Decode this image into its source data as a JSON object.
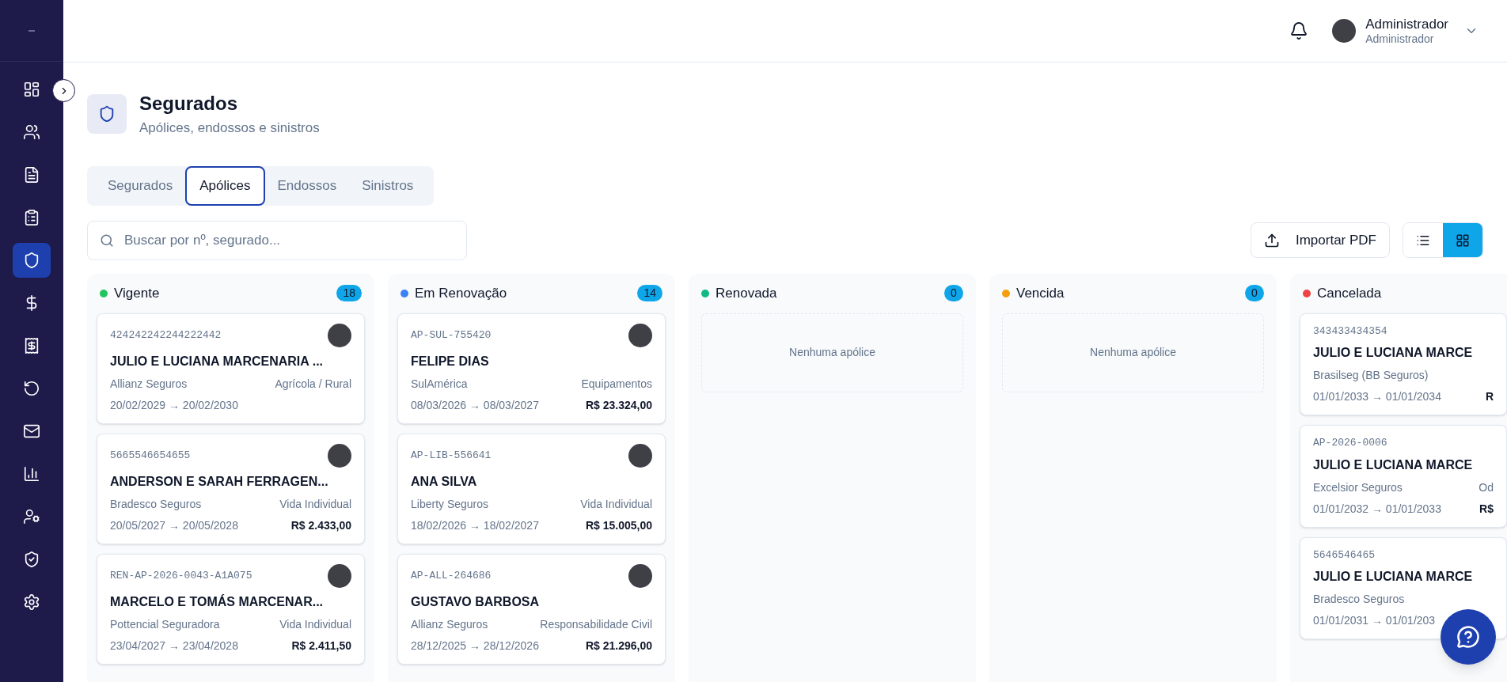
{
  "sidebar": {
    "items": [
      {
        "selected": false
      },
      {
        "selected": false
      },
      {
        "selected": false
      },
      {
        "selected": false
      },
      {
        "selected": true
      },
      {
        "selected": false
      },
      {
        "selected": false
      },
      {
        "selected": false
      },
      {
        "selected": false
      },
      {
        "selected": false
      },
      {
        "selected": false
      },
      {
        "selected": false
      },
      {
        "selected": false
      }
    ]
  },
  "header": {
    "user_name": "Administrador",
    "user_role": "Administrador"
  },
  "page": {
    "title": "Segurados",
    "subtitle": "Apólices, endossos e sinistros"
  },
  "tabs": [
    {
      "label": "Segurados",
      "selected": false
    },
    {
      "label": "Apólices",
      "selected": true
    },
    {
      "label": "Endossos",
      "selected": false
    },
    {
      "label": "Sinistros",
      "selected": false
    }
  ],
  "search": {
    "placeholder": "Buscar por nº, segurado..."
  },
  "import_button": {
    "label": "Importar PDF"
  },
  "view_toggle": [
    {
      "selected": false
    },
    {
      "selected": true
    }
  ],
  "columns": [
    {
      "title": "Vigente",
      "color": "#22c55e",
      "count": "18",
      "cards": [
        {
          "id": "424242242244222442",
          "name": "JULIO E LUCIANA MARCENARIA ...",
          "insurer": "Allianz Seguros",
          "category": "Agrícola / Rural",
          "dates": "20/02/2029 → 20/02/2030"
        },
        {
          "id": "5665546654655",
          "name": "ANDERSON E SARAH FERRAGEN...",
          "insurer": "Bradesco Seguros",
          "category": "Vida Individual",
          "dates": "20/05/2027 → 20/05/2028",
          "value": "R$ 2.433,00"
        },
        {
          "id": "REN-AP-2026-0043-A1A075",
          "name": "MARCELO E TOMÁS MARCENAR...",
          "insurer": "Pottencial Seguradora",
          "category": "Vida Individual",
          "dates": "23/04/2027 → 23/04/2028",
          "value": "R$ 2.411,50"
        }
      ]
    },
    {
      "title": "Em Renovação",
      "color": "#3b82f6",
      "count": "14",
      "cards": [
        {
          "id": "AP-SUL-755420",
          "name": "FELIPE DIAS",
          "insurer": "SulAmérica",
          "category": "Equipamentos",
          "dates": "08/03/2026 → 08/03/2027",
          "value": "R$ 23.324,00"
        },
        {
          "id": "AP-LIB-556641",
          "name": "ANA SILVA",
          "insurer": "Liberty Seguros",
          "category": "Vida Individual",
          "dates": "18/02/2026 → 18/02/2027",
          "value": "R$ 15.005,00"
        },
        {
          "id": "AP-ALL-264686",
          "name": "GUSTAVO BARBOSA",
          "insurer": "Allianz Seguros",
          "category": "Responsabilidade Civil",
          "dates": "28/12/2025 → 28/12/2026",
          "value": "R$ 21.296,00"
        }
      ]
    },
    {
      "title": "Renovada",
      "color": "#10b981",
      "count": "0",
      "empty_text": "Nenhuma apólice"
    },
    {
      "title": "Vencida",
      "color": "#f59e0b",
      "count": "0",
      "empty_text": "Nenhuma apólice"
    },
    {
      "title": "Cancelada",
      "color": "#ef4444",
      "cards": [
        {
          "id": "343433434354",
          "name": "JULIO E LUCIANA MARCE",
          "insurer": "Brasilseg (BB Seguros)",
          "dates": "01/01/2033 → 01/01/2034",
          "value": "R"
        },
        {
          "id": "AP-2026-0006",
          "name": "JULIO E LUCIANA MARCE",
          "insurer": "Excelsior Seguros",
          "category": "Od",
          "dates": "01/01/2032 → 01/01/2033",
          "value": "R$"
        },
        {
          "id": "5646546465",
          "name": "JULIO E LUCIANA MARCE",
          "insurer": "Bradesco Seguros",
          "dates": "01/01/2031 → 01/01/203"
        }
      ]
    }
  ]
}
